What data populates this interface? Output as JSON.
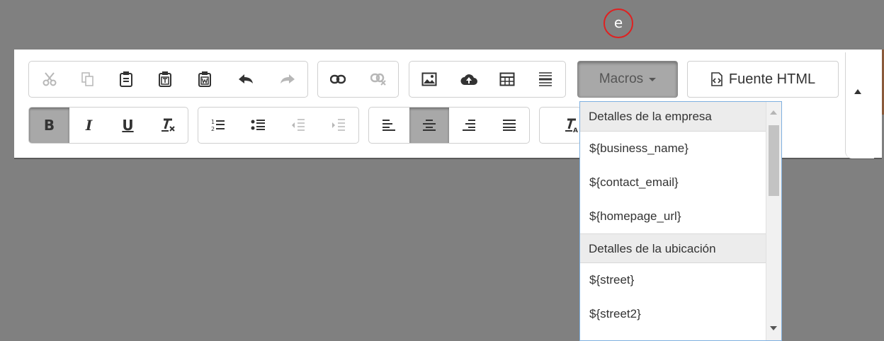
{
  "marker": {
    "label": "e"
  },
  "toolbar": {
    "macros_label": "Macros",
    "source_label": "Fuente HTML",
    "row1": {
      "clipboard": [
        "cut-icon",
        "copy-icon",
        "paste-icon",
        "paste-text-icon",
        "paste-word-icon",
        "undo-icon",
        "redo-icon"
      ],
      "links": [
        "link-icon",
        "unlink-icon"
      ],
      "insert": [
        "image-icon",
        "upload-icon",
        "table-icon",
        "horizontal-rule-icon"
      ]
    },
    "row2": {
      "basic_styles": {
        "bold": "B",
        "italic": "I",
        "underline": "U"
      },
      "lists": [
        "numbered-list-icon",
        "bulleted-list-icon",
        "outdent-icon",
        "indent-icon"
      ],
      "align": [
        "align-left-icon",
        "align-center-icon",
        "align-right-icon",
        "justify-icon"
      ]
    }
  },
  "macros_menu": {
    "groups": [
      {
        "header": "Detalles de la empresa",
        "items": [
          "${business_name}",
          "${contact_email}",
          "${homepage_url}"
        ]
      },
      {
        "header": "Detalles de la ubicación",
        "items": [
          "${street}",
          "${street2}"
        ]
      }
    ]
  },
  "colors": {
    "background": "#808080",
    "active_button": "#a8a8a8",
    "dropdown_border": "#7fb0e0",
    "marker": "#e02020"
  }
}
